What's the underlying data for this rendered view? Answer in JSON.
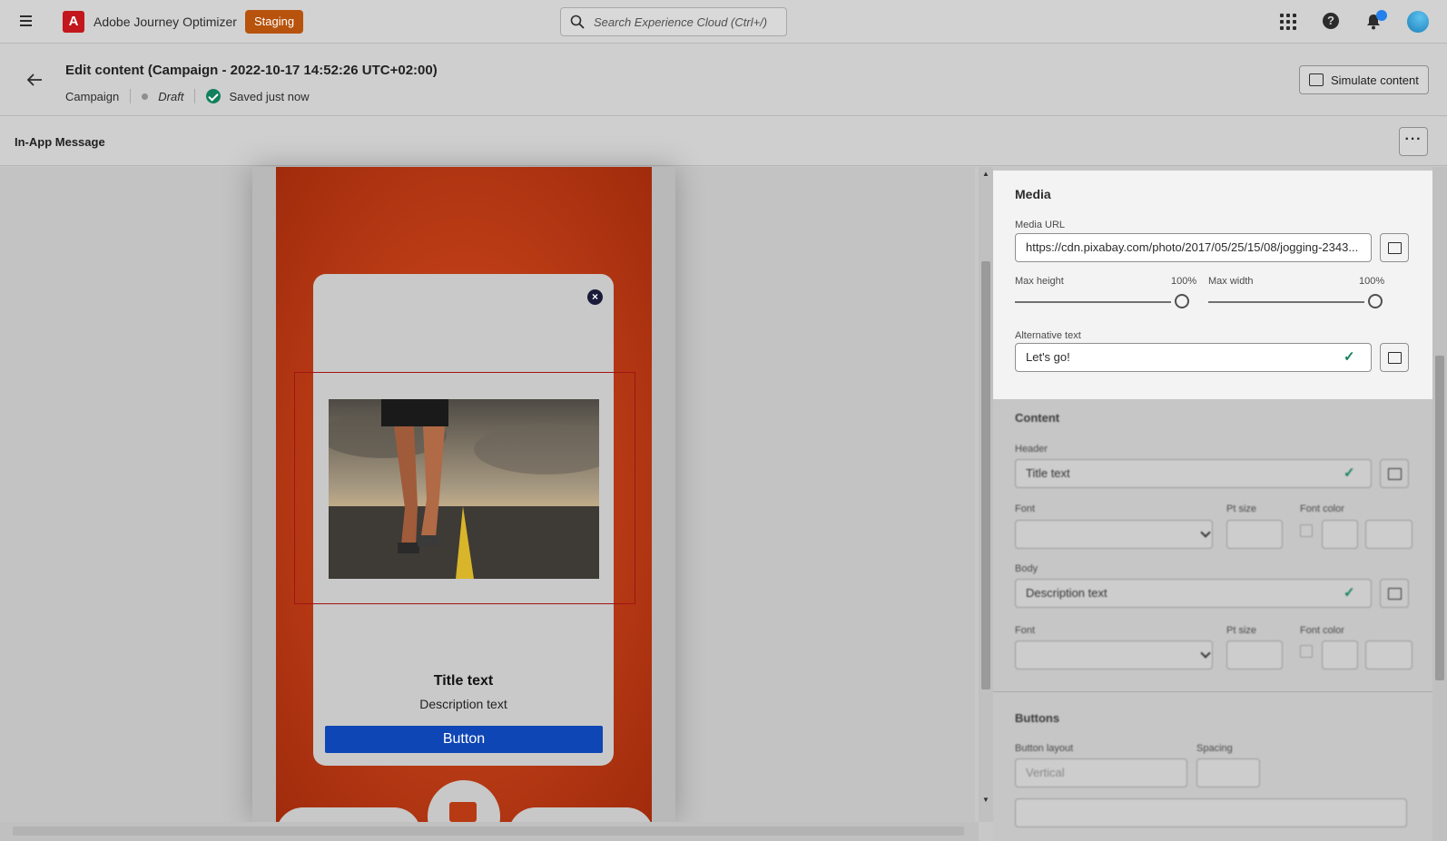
{
  "shell": {
    "app_name": "Adobe Journey Optimizer",
    "environment": "Staging",
    "search_placeholder": "Search Experience Cloud (Ctrl+/)"
  },
  "header": {
    "title": "Edit content (Campaign - 2022-10-17 14:52:26 UTC+02:00)",
    "breadcrumb": "Campaign",
    "status": "Draft",
    "save_status": "Saved just now",
    "simulate_label": "Simulate content"
  },
  "subheader": {
    "label": "In-App Message"
  },
  "preview": {
    "title": "Title text",
    "description": "Description text",
    "button": "Button"
  },
  "media": {
    "section_title": "Media",
    "url_label": "Media URL",
    "url_value": "https://cdn.pixabay.com/photo/2017/05/25/15/08/jogging-2343...",
    "max_height_label": "Max height",
    "max_height_value": "100%",
    "max_width_label": "Max width",
    "max_width_value": "100%",
    "alt_label": "Alternative text",
    "alt_value": "Let's go!"
  },
  "content": {
    "section_title": "Content",
    "header_label": "Header",
    "header_value": "Title text",
    "font_label": "Font",
    "pt_label": "Pt size",
    "color_label": "Font color",
    "body_label": "Body",
    "body_value": "Description text"
  },
  "buttons": {
    "section_title": "Buttons",
    "layout_label": "Button layout",
    "layout_value": "Vertical",
    "spacing_label": "Spacing"
  }
}
